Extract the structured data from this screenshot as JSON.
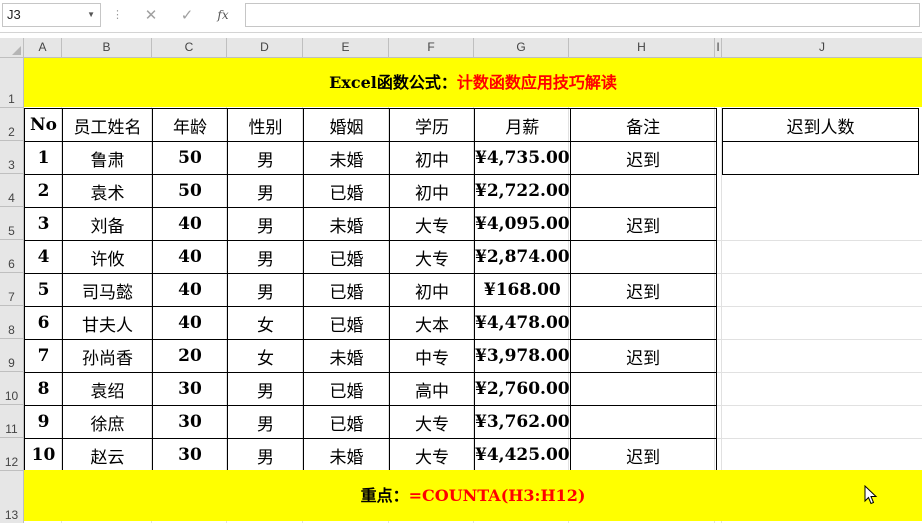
{
  "formula_bar": {
    "name_box": "J3",
    "fx_label": "fx",
    "formula": ""
  },
  "columns": [
    "A",
    "B",
    "C",
    "D",
    "E",
    "F",
    "G",
    "H",
    "I",
    "J"
  ],
  "rows": [
    "1",
    "2",
    "3",
    "4",
    "5",
    "6",
    "7",
    "8",
    "9",
    "10",
    "11",
    "12",
    "13"
  ],
  "title": {
    "prefix": "Excel函数公式：",
    "highlight": "计数函数应用技巧解读"
  },
  "table": {
    "headers": [
      "No",
      "员工姓名",
      "年龄",
      "性别",
      "婚姻",
      "学历",
      "月薪",
      "备注"
    ],
    "rows": [
      [
        "1",
        "鲁肃",
        "50",
        "男",
        "未婚",
        "初中",
        "¥4,735.00",
        "迟到"
      ],
      [
        "2",
        "袁术",
        "50",
        "男",
        "已婚",
        "初中",
        "¥2,722.00",
        ""
      ],
      [
        "3",
        "刘备",
        "40",
        "男",
        "未婚",
        "大专",
        "¥4,095.00",
        "迟到"
      ],
      [
        "4",
        "许攸",
        "40",
        "男",
        "已婚",
        "大专",
        "¥2,874.00",
        ""
      ],
      [
        "5",
        "司马懿",
        "40",
        "男",
        "已婚",
        "初中",
        "¥168.00",
        "迟到"
      ],
      [
        "6",
        "甘夫人",
        "40",
        "女",
        "已婚",
        "大本",
        "¥4,478.00",
        ""
      ],
      [
        "7",
        "孙尚香",
        "20",
        "女",
        "未婚",
        "中专",
        "¥3,978.00",
        "迟到"
      ],
      [
        "8",
        "袁绍",
        "30",
        "男",
        "已婚",
        "高中",
        "¥2,760.00",
        ""
      ],
      [
        "9",
        "徐庶",
        "30",
        "男",
        "已婚",
        "大专",
        "¥3,762.00",
        ""
      ],
      [
        "10",
        "赵云",
        "30",
        "男",
        "未婚",
        "大专",
        "¥4,425.00",
        "迟到"
      ]
    ]
  },
  "side": {
    "header": "迟到人数",
    "value": ""
  },
  "note": {
    "prefix": "重点：",
    "formula": "=COUNTA(H3:H12)"
  },
  "colors": {
    "band": "#ffff00",
    "highlight": "#ff0000"
  }
}
